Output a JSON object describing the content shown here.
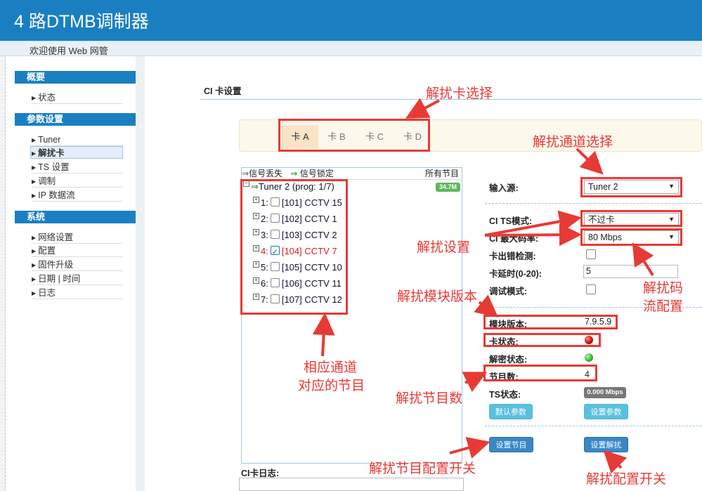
{
  "header": {
    "title": "4 路DTMB调制器",
    "welcome": "欢迎使用 Web 网管"
  },
  "sidebar": {
    "sections": [
      {
        "title": "概要",
        "items": [
          {
            "label": "状态"
          }
        ]
      },
      {
        "title": "参数设置",
        "items": [
          {
            "label": "Tuner"
          },
          {
            "label": "解扰卡",
            "active": true
          },
          {
            "label": "TS 设置"
          },
          {
            "label": "调制"
          },
          {
            "label": "IP 数据流"
          }
        ]
      },
      {
        "title": "系统",
        "items": [
          {
            "label": "网络设置"
          },
          {
            "label": "配置"
          },
          {
            "label": "固件升级"
          },
          {
            "label": "日期 | 时间"
          },
          {
            "label": "日志"
          }
        ]
      }
    ]
  },
  "ci": {
    "title": "CI 卡设置",
    "tabs": [
      {
        "label": "卡 A",
        "active": true
      },
      {
        "label": "卡 B"
      },
      {
        "label": "卡 C"
      },
      {
        "label": "卡 D"
      }
    ],
    "tree": {
      "legend_lost": "信号丢失",
      "legend_locked": "信号锁定",
      "legend_all": "所有节目",
      "root": "Tuner 2 (prog: 1/7)",
      "root_bitrate": "34.7M",
      "programs": [
        {
          "index": "1:",
          "label": "[101] CCTV 15",
          "checked": false
        },
        {
          "index": "2:",
          "label": "[102] CCTV 1",
          "checked": false
        },
        {
          "index": "3:",
          "label": "[103] CCTV 2",
          "checked": false
        },
        {
          "index": "4:",
          "label": "[104] CCTV 7",
          "checked": true
        },
        {
          "index": "5:",
          "label": "[105] CCTV 10",
          "checked": false
        },
        {
          "index": "6:",
          "label": "[106] CCTV 11",
          "checked": false
        },
        {
          "index": "7:",
          "label": "[107] CCTV 12",
          "checked": false
        }
      ]
    },
    "log_label": "CI卡日志:",
    "form": {
      "input_source_label": "输入源:",
      "input_source_value": "Tuner 2",
      "ts_mode_label": "CI TS模式:",
      "ts_mode_value": "不过卡",
      "max_rate_label": "CI 最大码率:",
      "max_rate_value": "80 Mbps",
      "card_error_label": "卡出错检测:",
      "card_error_checked": false,
      "delay_label": "卡延时(0-20):",
      "delay_value": "5",
      "debug_label": "调试模式:",
      "debug_checked": false,
      "module_version_label": "模块版本:",
      "module_version_value": "7.9.5.9",
      "card_status_label": "卡状态:",
      "card_status_color": "#cc0000",
      "decrypt_status_label": "解密状态:",
      "decrypt_status_color": "#2fb52f",
      "program_count_label": "节目数:",
      "program_count_value": "4",
      "ts_status_label": "TS状态:",
      "ts_status_value": "0.000 Mbps",
      "btn_default_params": "默认参数",
      "btn_set_params": "设置参数",
      "btn_set_programs": "设置节目",
      "btn_set_descramble": "设置解扰"
    }
  },
  "annotations": {
    "card_select": "解扰卡选择",
    "channel_select": "解扰通道选择",
    "descramble_settings": "解扰设置",
    "rate_config_line1": "解扰码",
    "rate_config_line2": "流配置",
    "module_version": "解扰模块版本",
    "programs_line1": "相应通道",
    "programs_line2": "对应的节目",
    "program_count": "解扰节目数",
    "program_config_switch": "解扰节目配置开关",
    "config_switch": "解扰配置开关",
    "color": "#e83a35"
  }
}
